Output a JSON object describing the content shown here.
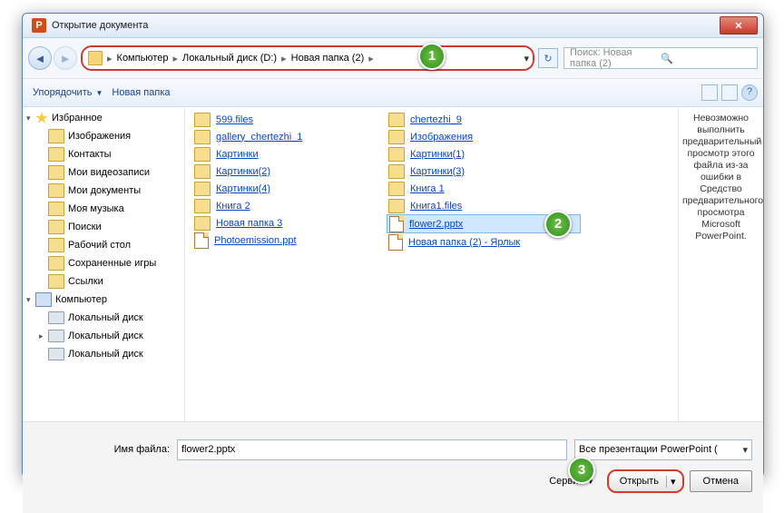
{
  "title": "Открытие документа",
  "appicon_letter": "P",
  "breadcrumb": {
    "items": [
      "Компьютер",
      "Локальный диск (D:)",
      "Новая папка (2)"
    ]
  },
  "search_placeholder": "Поиск: Новая папка (2)",
  "toolbar": {
    "organize": "Упорядочить",
    "new_folder": "Новая папка"
  },
  "tree": [
    {
      "indent": 0,
      "icon": "star",
      "label": "Избранное",
      "arrow": "▾"
    },
    {
      "indent": 1,
      "icon": "folder",
      "label": "Изображения"
    },
    {
      "indent": 1,
      "icon": "folder",
      "label": "Контакты"
    },
    {
      "indent": 1,
      "icon": "folder",
      "label": "Мои видеозаписи"
    },
    {
      "indent": 1,
      "icon": "folder",
      "label": "Мои документы"
    },
    {
      "indent": 1,
      "icon": "folder",
      "label": "Моя музыка"
    },
    {
      "indent": 1,
      "icon": "folder",
      "label": "Поиски"
    },
    {
      "indent": 1,
      "icon": "folder",
      "label": "Рабочий стол"
    },
    {
      "indent": 1,
      "icon": "folder",
      "label": "Сохраненные игры"
    },
    {
      "indent": 1,
      "icon": "folder",
      "label": "Ссылки"
    },
    {
      "indent": 0,
      "icon": "comp",
      "label": "Компьютер",
      "arrow": "▾"
    },
    {
      "indent": 1,
      "icon": "drive",
      "label": "Локальный диск"
    },
    {
      "indent": 1,
      "icon": "drive",
      "label": "Локальный диск",
      "arrow": "▸"
    },
    {
      "indent": 1,
      "icon": "drive",
      "label": "Локальный диск"
    }
  ],
  "files_col1": [
    {
      "icon": "folder",
      "name": "599.files"
    },
    {
      "icon": "folder",
      "name": "gallery_chertezhi_1"
    },
    {
      "icon": "folder",
      "name": "Картинки"
    },
    {
      "icon": "folder",
      "name": "Картинки(2)"
    },
    {
      "icon": "folder",
      "name": "Картинки(4)"
    },
    {
      "icon": "folder",
      "name": "Книга 2"
    },
    {
      "icon": "folder",
      "name": "Новая папка 3"
    },
    {
      "icon": "doc",
      "name": "Photoemission.ppt"
    }
  ],
  "files_col2": [
    {
      "icon": "folder",
      "name": "chertezhi_9"
    },
    {
      "icon": "folder",
      "name": "Изображения"
    },
    {
      "icon": "folder",
      "name": "Картинки(1)"
    },
    {
      "icon": "folder",
      "name": "Картинки(3)"
    },
    {
      "icon": "folder",
      "name": "Книга 1"
    },
    {
      "icon": "folder",
      "name": "Книга1.files"
    },
    {
      "icon": "doc",
      "name": "flower2.pptx",
      "selected": true
    },
    {
      "icon": "doc",
      "name": "Новая папка (2) - Ярлык"
    }
  ],
  "preview_text": "Невозможно выполнить предварительный просмотр этого файла из-за ошибки в Средство предварительного просмотра Microsoft PowerPoint.",
  "filename_label": "Имя файла:",
  "filename_value": "flower2.pptx",
  "filter_value": "Все презентации PowerPoint (",
  "service": "Сервис",
  "open": "Открыть",
  "cancel": "Отмена",
  "callouts": {
    "c1": "1",
    "c2": "2",
    "c3": "3"
  }
}
